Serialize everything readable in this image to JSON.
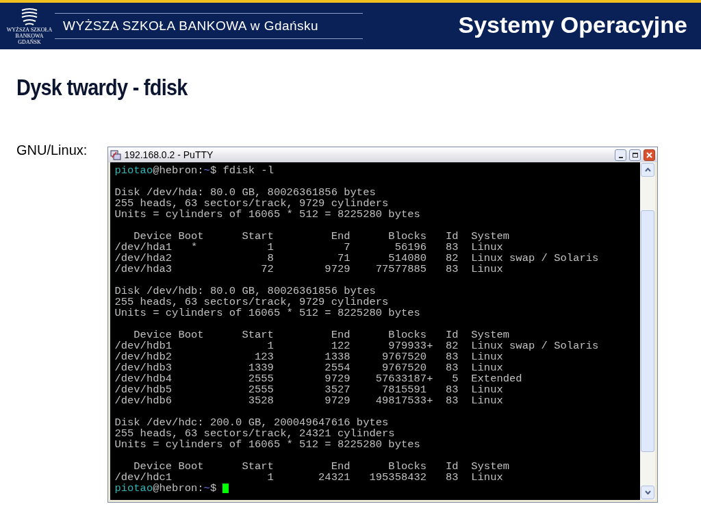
{
  "header": {
    "logo_lines": [
      "WYŻSZA SZKOŁA",
      "BANKOWA",
      "GDAŃSK"
    ],
    "school": "WYŻSZA SZKOŁA BANKOWA w Gdańsku",
    "course": "Systemy Operacyjne"
  },
  "slide": {
    "title": "Dysk twardy - fdisk",
    "label": "GNU/Linux:"
  },
  "window": {
    "title": "192.168.0.2 - PuTTY",
    "lines": [
      {
        "kind": "prompt",
        "user": "piotao",
        "host": "@hebron:",
        "path": "~",
        "command": "$ fdisk -l",
        "cursor": false
      },
      {
        "kind": "blank"
      },
      {
        "kind": "text",
        "text": "Disk /dev/hda: 80.0 GB, 80026361856 bytes"
      },
      {
        "kind": "text",
        "text": "255 heads, 63 sectors/track, 9729 cylinders"
      },
      {
        "kind": "text",
        "text": "Units = cylinders of 16065 * 512 = 8225280 bytes"
      },
      {
        "kind": "blank"
      },
      {
        "kind": "text",
        "text": "   Device Boot      Start         End      Blocks   Id  System"
      },
      {
        "kind": "text",
        "text": "/dev/hda1   *           1           7       56196   83  Linux"
      },
      {
        "kind": "text",
        "text": "/dev/hda2               8          71      514080   82  Linux swap / Solaris"
      },
      {
        "kind": "text",
        "text": "/dev/hda3              72        9729    77577885   83  Linux"
      },
      {
        "kind": "blank"
      },
      {
        "kind": "text",
        "text": "Disk /dev/hdb: 80.0 GB, 80026361856 bytes"
      },
      {
        "kind": "text",
        "text": "255 heads, 63 sectors/track, 9729 cylinders"
      },
      {
        "kind": "text",
        "text": "Units = cylinders of 16065 * 512 = 8225280 bytes"
      },
      {
        "kind": "blank"
      },
      {
        "kind": "text",
        "text": "   Device Boot      Start         End      Blocks   Id  System"
      },
      {
        "kind": "text",
        "text": "/dev/hdb1               1         122      979933+  82  Linux swap / Solaris"
      },
      {
        "kind": "text",
        "text": "/dev/hdb2             123        1338     9767520   83  Linux"
      },
      {
        "kind": "text",
        "text": "/dev/hdb3            1339        2554     9767520   83  Linux"
      },
      {
        "kind": "text",
        "text": "/dev/hdb4            2555        9729    57633187+   5  Extended"
      },
      {
        "kind": "text",
        "text": "/dev/hdb5            2555        3527     7815591   83  Linux"
      },
      {
        "kind": "text",
        "text": "/dev/hdb6            3528        9729    49817533+  83  Linux"
      },
      {
        "kind": "blank"
      },
      {
        "kind": "text",
        "text": "Disk /dev/hdc: 200.0 GB, 200049647616 bytes"
      },
      {
        "kind": "text",
        "text": "255 heads, 63 sectors/track, 24321 cylinders"
      },
      {
        "kind": "text",
        "text": "Units = cylinders of 16065 * 512 = 8225280 bytes"
      },
      {
        "kind": "blank"
      },
      {
        "kind": "text",
        "text": "   Device Boot      Start         End      Blocks   Id  System"
      },
      {
        "kind": "text",
        "text": "/dev/hdc1               1       24321   195358432   83  Linux"
      },
      {
        "kind": "prompt",
        "user": "piotao",
        "host": "@hebron:",
        "path": "~",
        "command": "$",
        "cursor": true
      }
    ]
  }
}
